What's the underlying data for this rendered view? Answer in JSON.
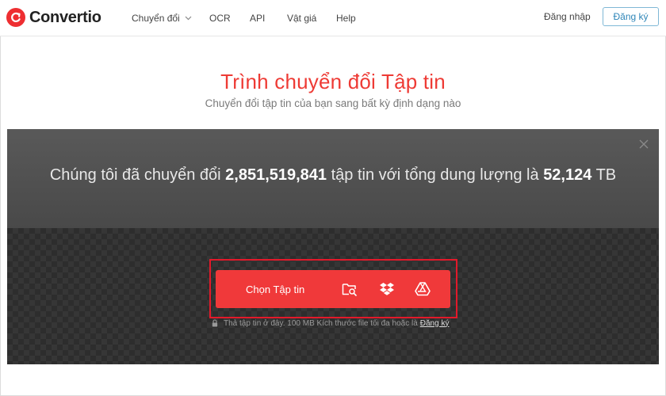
{
  "header": {
    "logo_text": "Convertio",
    "nav": [
      {
        "label": "Chuyển đổi",
        "has_dropdown": true
      },
      {
        "label": "OCR"
      },
      {
        "label": "API"
      },
      {
        "label": "Vật giá"
      },
      {
        "label": "Help"
      }
    ],
    "login_label": "Đăng nhập",
    "signup_label": "Đăng ký"
  },
  "hero": {
    "title": "Trình chuyển đổi Tập tin",
    "subtitle": "Chuyển đổi tập tin của bạn sang bất kỳ định dạng nào"
  },
  "stats": {
    "prefix": "Chúng tôi đã chuyển đổi",
    "files_count": "2,851,519,841",
    "middle": "tập tin với tổng dung lượng là",
    "total_size": "52,124",
    "unit": "TB"
  },
  "upload": {
    "choose_label": "Chọn Tập tin",
    "icons": [
      "folder-search-icon",
      "dropbox-icon",
      "google-drive-icon"
    ],
    "hint_text": "Thả tập tin ở đây. 100 MB Kích thước file tối đa hoặc là",
    "hint_link": "Đăng ký"
  },
  "colors": {
    "brand_red": "#ee3b35",
    "button_red": "#f0393a",
    "highlight_red": "#e3192a",
    "signup_blue": "#2f86b8"
  }
}
